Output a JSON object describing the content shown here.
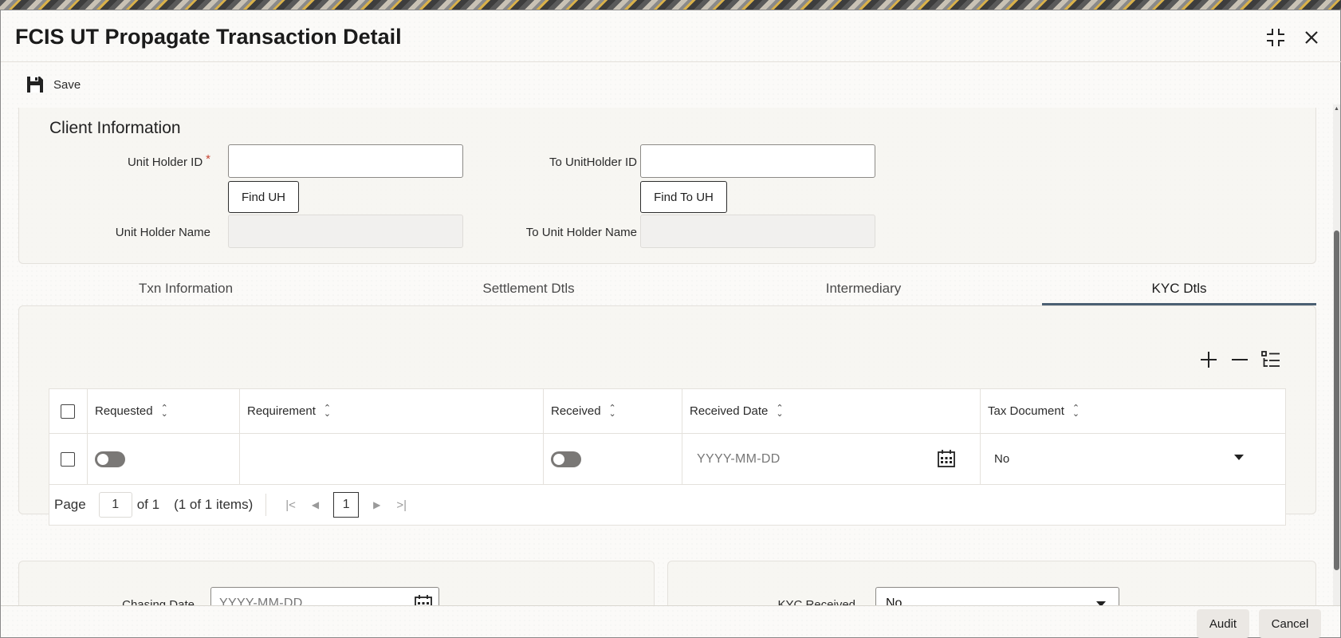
{
  "window": {
    "title": "FCIS UT Propagate Transaction Detail"
  },
  "toolbar": {
    "save_label": "Save"
  },
  "client_info": {
    "section_title": "Client Information",
    "unit_holder_id_label": "Unit Holder ID",
    "unit_holder_id_value": "",
    "required_mark": "*",
    "find_uh_label": "Find UH",
    "unit_holder_name_label": "Unit Holder Name",
    "unit_holder_name_value": "",
    "to_unitholder_id_label": "To UnitHolder ID",
    "to_unitholder_id_value": "",
    "find_to_uh_label": "Find To UH",
    "to_unit_holder_name_label": "To Unit Holder Name",
    "to_unit_holder_name_value": ""
  },
  "tabs": [
    {
      "label": "Txn Information",
      "active": false
    },
    {
      "label": "Settlement Dtls",
      "active": false
    },
    {
      "label": "Intermediary",
      "active": false
    },
    {
      "label": "KYC Dtls",
      "active": true
    }
  ],
  "kyc_grid": {
    "columns": [
      "Requested",
      "Requirement",
      "Received",
      "Received Date",
      "Tax Document"
    ],
    "rows": [
      {
        "requested": false,
        "requirement": "",
        "received": false,
        "received_date_placeholder": "YYYY-MM-DD",
        "tax_document": "No"
      }
    ],
    "pager": {
      "page_label": "Page",
      "page_value": "1",
      "of_label": "of 1",
      "items_label": "(1 of 1 items)",
      "current_page": "1"
    }
  },
  "lower": {
    "chasing_date_label": "Chasing Date",
    "chasing_date_placeholder": "YYYY-MM-DD",
    "kyc_received_label": "KYC Received",
    "kyc_received_value": "No"
  },
  "footer": {
    "audit_label": "Audit",
    "cancel_label": "Cancel"
  },
  "icons": {
    "maximize": "collapse-icon",
    "close": "close-icon",
    "save": "floppy-disk-icon",
    "add_row": "plus-icon",
    "delete_row": "minus-icon",
    "single_record_view": "list-view-icon",
    "calendar": "calendar-icon"
  }
}
